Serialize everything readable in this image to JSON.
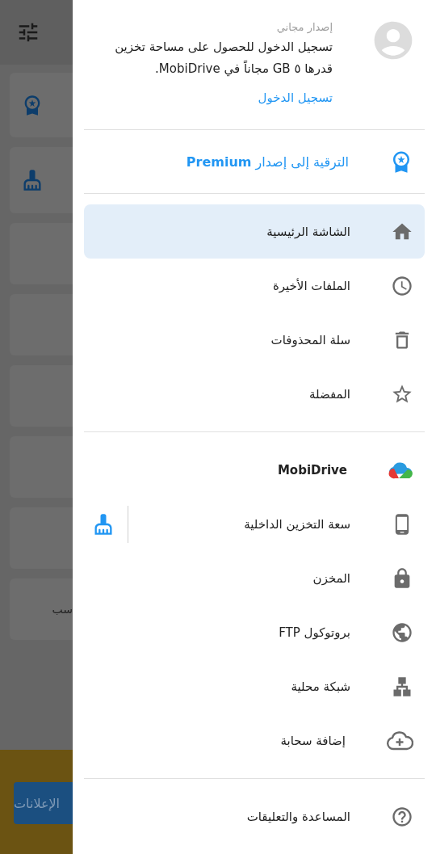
{
  "background": {
    "card_text": "سب",
    "ads_button": "الإعلانات"
  },
  "drawer": {
    "account": {
      "edition": "إصدار مجاني",
      "message": "تسجيل الدخول للحصول على مساحة تخزين قدرها ٥ GB مجاناً في MobiDrive.",
      "sign_in": "تسجيل الدخول"
    },
    "upgrade": "الترقية إلى إصدار **Premium**",
    "sections": [
      {
        "items": [
          {
            "label": "الشاشة الرئيسية",
            "kind": "plain",
            "selected": true
          },
          {
            "label": "الملفات الأخيرة",
            "kind": "plain",
            "selected": false
          },
          {
            "label": "سلة المحذوفات",
            "kind": "plain",
            "selected": false
          },
          {
            "label": "المفضلة",
            "kind": "plain",
            "selected": false
          }
        ]
      },
      {
        "items": [
          {
            "label": "MobiDrive",
            "kind": "brand",
            "selected": false
          },
          {
            "label": "سعة التخزين الداخلية",
            "kind": "storage",
            "selected": false
          },
          {
            "label": "المخزن",
            "kind": "plain",
            "selected": false
          },
          {
            "label": "بروتوكول FTP",
            "kind": "plain",
            "selected": false
          },
          {
            "label": "شبكة محلية",
            "kind": "plain",
            "selected": false
          },
          {
            "label": "إضافة سحابة",
            "kind": "plain",
            "selected": false
          }
        ]
      },
      {
        "items": [
          {
            "label": "المساعدة والتعليقات",
            "kind": "plain",
            "selected": false
          }
        ]
      }
    ]
  }
}
